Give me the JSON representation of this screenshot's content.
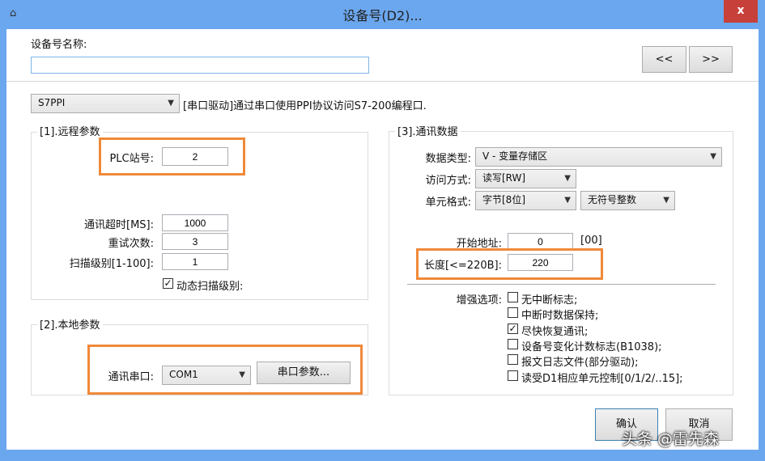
{
  "window": {
    "title": "设备号(D2)...",
    "close": "x",
    "icon": "⌂"
  },
  "header": {
    "name_label": "设备号名称:",
    "name_value": "",
    "prev": "<<",
    "next": ">>"
  },
  "driver": {
    "selected": "S7PPI",
    "description": "[串口驱动]通过串口使用PPI协议访问S7-200编程口."
  },
  "remote": {
    "legend": "[1].远程参数",
    "plc_label": "PLC站号:",
    "plc_value": "2",
    "timeout_label": "通讯超时[MS]:",
    "timeout_value": "1000",
    "retry_label": "重试次数:",
    "retry_value": "3",
    "scan_label": "扫描级别[1-100]:",
    "scan_value": "1",
    "dynamic_label": "动态扫描级别:",
    "dynamic_checked": true
  },
  "local": {
    "legend": "[2].本地参数",
    "port_label": "通讯串口:",
    "port_value": "COM1",
    "port_params": "串口参数..."
  },
  "comm": {
    "legend": "[3].通讯数据",
    "type_label": "数据类型:",
    "type_value": "V - 变量存储区",
    "access_label": "访问方式:",
    "access_value": "读写[RW]",
    "format_label": "单元格式:",
    "format_value": "字节[8位]",
    "format2_value": "无符号整数",
    "start_label": "开始地址:",
    "start_value": "0",
    "start_hex": "[00]",
    "length_label": "长度[<=220B]:",
    "length_value": "220",
    "options_label": "增强选项:",
    "options": [
      {
        "label": "无中断标志;",
        "checked": false
      },
      {
        "label": "中断时数据保持;",
        "checked": false
      },
      {
        "label": "尽快恢复通讯;",
        "checked": true
      },
      {
        "label": "设备号变化计数标志(B1038);",
        "checked": false
      },
      {
        "label": "报文日志文件(部分驱动);",
        "checked": false
      },
      {
        "label": "读受D1相应单元控制[0/1/2/..15];",
        "checked": false
      }
    ]
  },
  "footer": {
    "ok": "确认",
    "cancel": "取消"
  },
  "watermark": "头条 @雷先森",
  "colors": {
    "titlebar": "#6ba7ee",
    "close": "#c7413a",
    "highlight": "#f0893a"
  }
}
